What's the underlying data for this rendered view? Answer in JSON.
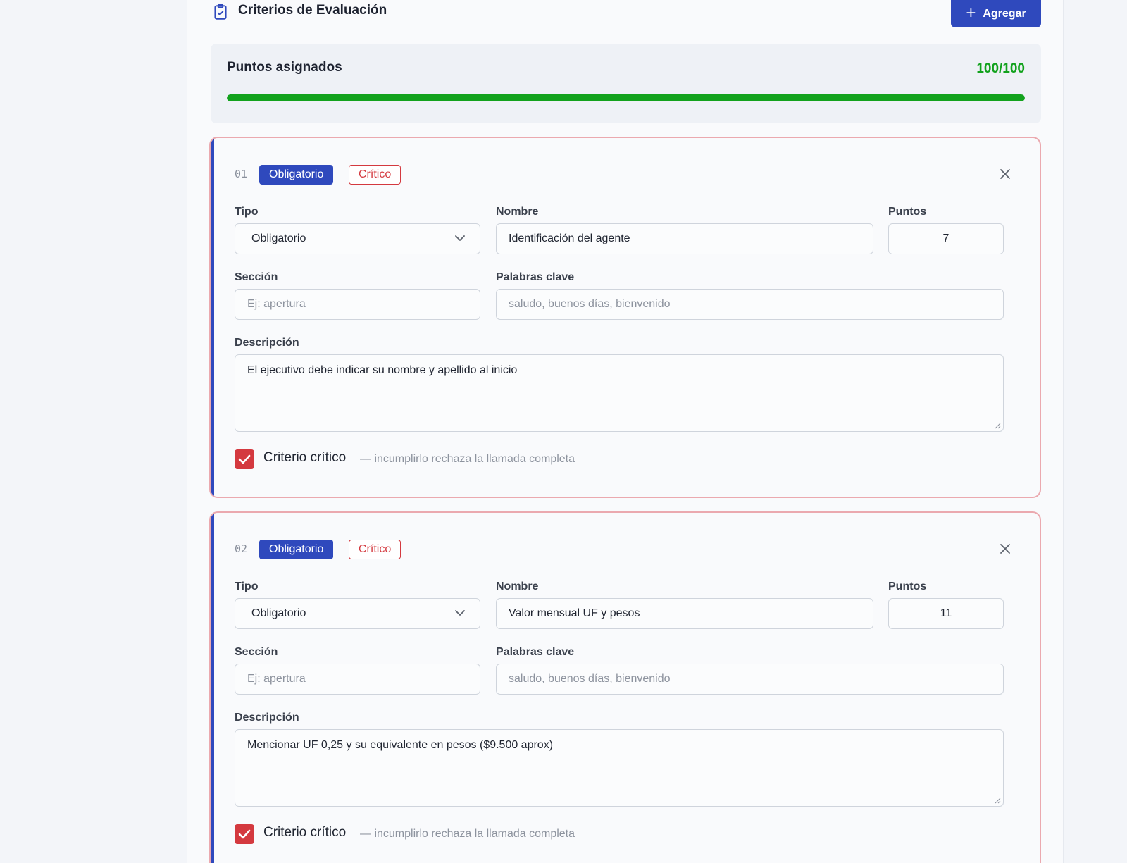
{
  "header": {
    "title": "Criterios de Evaluación",
    "add_label": "Agregar",
    "icon": "clipboard-check-icon"
  },
  "points": {
    "label": "Puntos asignados",
    "value": "100/100",
    "progress_fraction": 1.0,
    "color": "#12a21d"
  },
  "colors": {
    "accent": "#2f49bd",
    "critical": "#d4393f",
    "card_border": "#eba9af"
  },
  "criteria": [
    {
      "number": "01",
      "type_badge": "Obligatorio",
      "critical_badge": "Crítico",
      "tipo_label": "Tipo",
      "tipo_value": "Obligatorio",
      "nombre_label": "Nombre",
      "nombre_value": "Identificación del agente",
      "puntos_label": "Puntos",
      "puntos_value": "7",
      "seccion_label": "Sección",
      "seccion_placeholder": "Ej: apertura",
      "palabras_label": "Palabras clave",
      "palabras_placeholder": "saludo, buenos días, bienvenido",
      "descripcion_label": "Descripción",
      "descripcion_value": "El ejecutivo debe indicar su nombre y apellido al inicio",
      "critico_checked": true,
      "critico_label": "Criterio crítico",
      "critico_hint": "— incumplirlo rechaza la llamada completa"
    },
    {
      "number": "02",
      "type_badge": "Obligatorio",
      "critical_badge": "Crítico",
      "tipo_label": "Tipo",
      "tipo_value": "Obligatorio",
      "nombre_label": "Nombre",
      "nombre_value": "Valor mensual UF y pesos",
      "puntos_label": "Puntos",
      "puntos_value": "11",
      "seccion_label": "Sección",
      "seccion_placeholder": "Ej: apertura",
      "palabras_label": "Palabras clave",
      "palabras_placeholder": "saludo, buenos días, bienvenido",
      "descripcion_label": "Descripción",
      "descripcion_value": "Mencionar UF 0,25 y su equivalente en pesos ($9.500 aprox)",
      "critico_checked": true,
      "critico_label": "Criterio crítico",
      "critico_hint": "— incumplirlo rechaza la llamada completa"
    }
  ]
}
